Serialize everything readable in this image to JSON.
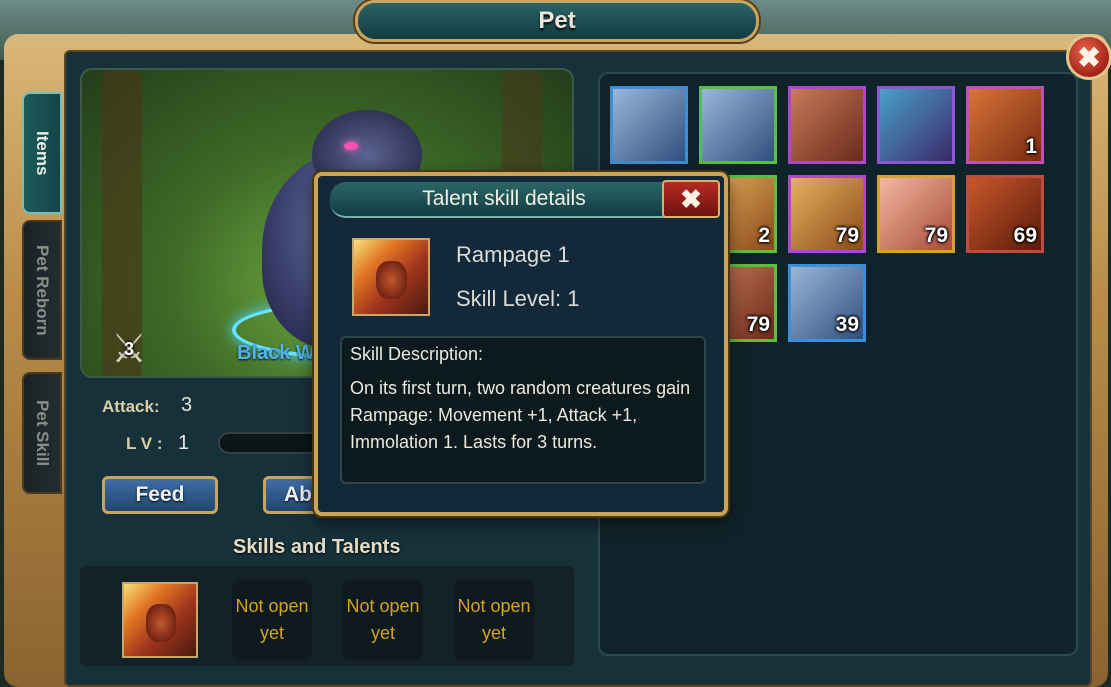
{
  "window": {
    "title": "Pet",
    "close_symbol": "✖"
  },
  "tabs": [
    {
      "label": "Items",
      "active": true
    },
    {
      "label": "Pet Reborn",
      "active": false
    },
    {
      "label": "Pet Skill",
      "active": false
    }
  ],
  "pet": {
    "name": "Black W",
    "level_badge": "3",
    "attack_label": "Attack:",
    "attack_value": "3",
    "lv_label": "L V :",
    "lv_value": "1"
  },
  "buttons": {
    "feed": "Feed",
    "second": "Ab"
  },
  "skills": {
    "title": "Skills and Talents",
    "locked_text": "Not open yet",
    "slots": [
      {
        "type": "skill",
        "icon": "rampage-skill-icon"
      },
      {
        "type": "locked",
        "text": "Not open yet"
      },
      {
        "type": "locked",
        "text": "Not open yet"
      },
      {
        "type": "locked",
        "text": "Not open yet"
      }
    ]
  },
  "inventory": {
    "items": [
      {
        "icon": "black-wolf-pet-icon",
        "count": "",
        "border": "#3b8fd6"
      },
      {
        "icon": "black-wolf-pet-icon",
        "count": "",
        "border": "#58c03a"
      },
      {
        "icon": "boar-pet-icon",
        "count": "",
        "border": "#b046c9"
      },
      {
        "icon": "dragon-pet-icon",
        "count": "",
        "border": "#8a56d6"
      },
      {
        "icon": "shrimp-food-icon",
        "count": "1",
        "border": "#c24fb8"
      },
      {
        "icon": "bread-food-icon",
        "count": "2",
        "border": "#58c03a"
      },
      {
        "icon": "bread-food-icon",
        "count": "79",
        "border": "#b046c9"
      },
      {
        "icon": "ham-food-icon",
        "count": "79",
        "border": "#d6a034"
      },
      {
        "icon": "meat-food-icon",
        "count": "69",
        "border": "#c24b3e"
      },
      {
        "icon": "boar-pet-icon",
        "count": "79",
        "border": "#58c03a"
      },
      {
        "icon": "black-wolf-pet-icon",
        "count": "39",
        "border": "#3b8fd6"
      }
    ]
  },
  "popup": {
    "title": "Talent skill details",
    "close_symbol": "✖",
    "skill_name": "Rampage 1",
    "skill_level": "Skill Level: 1",
    "desc_title": "Skill Description:",
    "desc_text": "On its first turn, two random creatures gain Rampage: Movement +1, Attack +1, Immolation 1.  Lasts for 3 turns."
  }
}
